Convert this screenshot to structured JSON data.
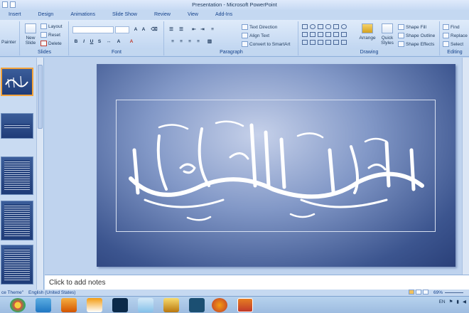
{
  "window": {
    "title": "Presentation - Microsoft PowerPoint"
  },
  "tabs": [
    "Insert",
    "Design",
    "Animations",
    "Slide Show",
    "Review",
    "View",
    "Add-Ins"
  ],
  "ribbon": {
    "clipboard": {
      "painter": "Painter"
    },
    "slides": {
      "label": "Slides",
      "new_slide": "New Slide",
      "layout": "Layout",
      "reset": "Reset",
      "delete": "Delete"
    },
    "font": {
      "label": "Font"
    },
    "paragraph": {
      "label": "Paragraph",
      "text_direction": "Text Direction",
      "align_text": "Align Text",
      "convert_smartart": "Convert to SmartArt"
    },
    "drawing": {
      "label": "Drawing",
      "arrange": "Arrange",
      "quick_styles": "Quick Styles",
      "shape_fill": "Shape Fill",
      "shape_outline": "Shape Outline",
      "shape_effects": "Shape Effects"
    },
    "editing": {
      "label": "Editing",
      "find": "Find",
      "replace": "Replace",
      "select": "Select"
    }
  },
  "notes": {
    "placeholder": "Click to add notes"
  },
  "status": {
    "theme": "ce Theme\"",
    "language": "English (United States)",
    "zoom": "69%"
  },
  "tray": {
    "lang": "EN"
  },
  "colors": {
    "accent": "#15428b",
    "slide_dark": "#2a4079",
    "selection": "#f3a33b"
  }
}
